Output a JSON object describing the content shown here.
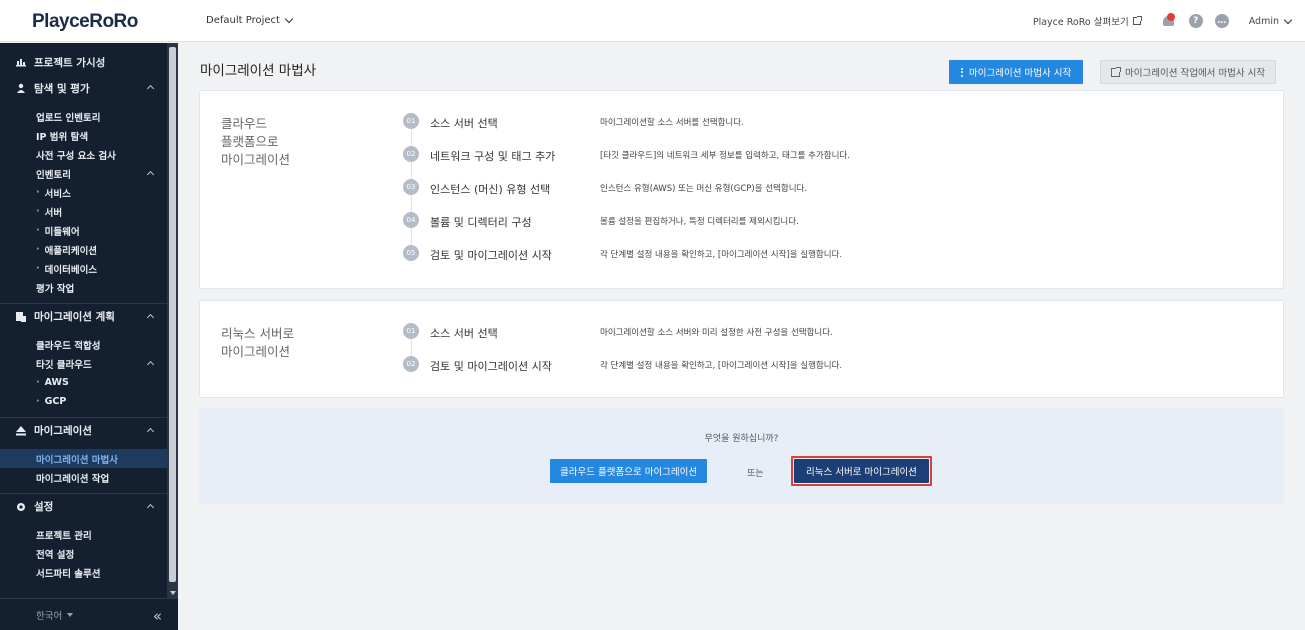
{
  "topbar": {
    "logo": "PlayceRoRo",
    "project": "Default Project",
    "preview_link": "Playce RoRo 살펴보기",
    "user": "Admin"
  },
  "sidebar": {
    "sections": [
      {
        "label": "프로젝트 가시성",
        "icon": "chart-icon"
      },
      {
        "label": "탐색 및 평가",
        "icon": "search-person-icon",
        "items": [
          "업로드 인벤토리",
          "IP 범위 탐색",
          "사전 구성 요소 검사",
          "인벤토리",
          "서비스",
          "서버",
          "미들웨어",
          "애플리케이션",
          "데이터베이스",
          "평가 작업"
        ]
      },
      {
        "label": "마이그레이션 계획",
        "icon": "plan-icon",
        "items": [
          "클라우드 적합성",
          "타깃 클라우드",
          "AWS",
          "GCP"
        ]
      },
      {
        "label": "마이그레이션",
        "icon": "migration-icon",
        "items": [
          "마이그레이션 마법사",
          "마이그레이션 작업"
        ]
      },
      {
        "label": "설정",
        "icon": "gear-icon",
        "items": [
          "프로젝트 관리",
          "전역 설정",
          "서드파티 솔루션"
        ]
      }
    ],
    "language": "한국어",
    "collapse": "«"
  },
  "main": {
    "title": "마이그레이션 마법사",
    "start_wizard_button": "마이그레이션 마법사 시작",
    "start_from_job_button": "마이그레이션 작업에서 마법사 시작",
    "cloud_card": {
      "title": [
        "클라우드",
        "플랫폼으로",
        "마이그레이션"
      ],
      "steps": [
        {
          "num": "01",
          "name": "소스 서버 선택",
          "desc": "마이그레이션할 소스 서버를 선택합니다."
        },
        {
          "num": "02",
          "name": "네트워크 구성 및 태그 추가",
          "desc": "[타깃 클라우드]의 네트워크 세부 정보를 입력하고, 태그를 추가합니다."
        },
        {
          "num": "03",
          "name": "인스턴스 (머신) 유형 선택",
          "desc": "인스턴스 유형(AWS) 또는 머신 유형(GCP)을 선택합니다."
        },
        {
          "num": "04",
          "name": "볼륨 및 디렉터리 구성",
          "desc": "볼륨 설정을 편집하거나, 특정 디렉터리를 제외시킵니다."
        },
        {
          "num": "05",
          "name": "검토 및 마이그레이션 시작",
          "desc": "각 단계별 설정 내용을 확인하고, [마이그레이션 시작]을 실행합니다."
        }
      ]
    },
    "linux_card": {
      "title": [
        "리눅스 서버로",
        "마이그레이션"
      ],
      "steps": [
        {
          "num": "01",
          "name": "소스 서버 선택",
          "desc": "마이그레이션할 소스 서버와 미리 설정한 사전 구성을 선택합니다."
        },
        {
          "num": "02",
          "name": "검토 및 마이그레이션 시작",
          "desc": "각 단계별 설정 내용을 확인하고, [마이그레이션 시작]을 실행합니다."
        }
      ]
    },
    "choice": {
      "question": "무엇을 원하십니까?",
      "cloud_button": "클라우드 플랫폼으로 마이그레이션",
      "or": "또는",
      "linux_button": "리눅스 서버로 마이그레이션"
    }
  }
}
